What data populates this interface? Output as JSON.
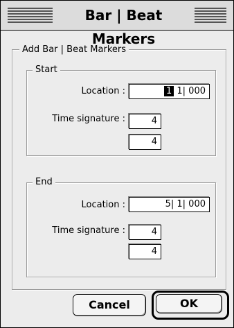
{
  "window": {
    "title": "Bar | Beat Markers"
  },
  "dialog": {
    "group_title": "Add Bar | Beat Markers",
    "start": {
      "title": "Start",
      "location_label": "Location :",
      "location_bar": "1",
      "location_rest": "1| 000",
      "timesig_label": "Time signature :",
      "timesig_numerator": "4",
      "timesig_denominator": "4"
    },
    "end": {
      "title": "End",
      "location_label": "Location :",
      "location_value": "5| 1| 000",
      "timesig_label": "Time signature :",
      "timesig_numerator": "4",
      "timesig_denominator": "4"
    }
  },
  "buttons": {
    "cancel": "Cancel",
    "ok": "OK"
  }
}
